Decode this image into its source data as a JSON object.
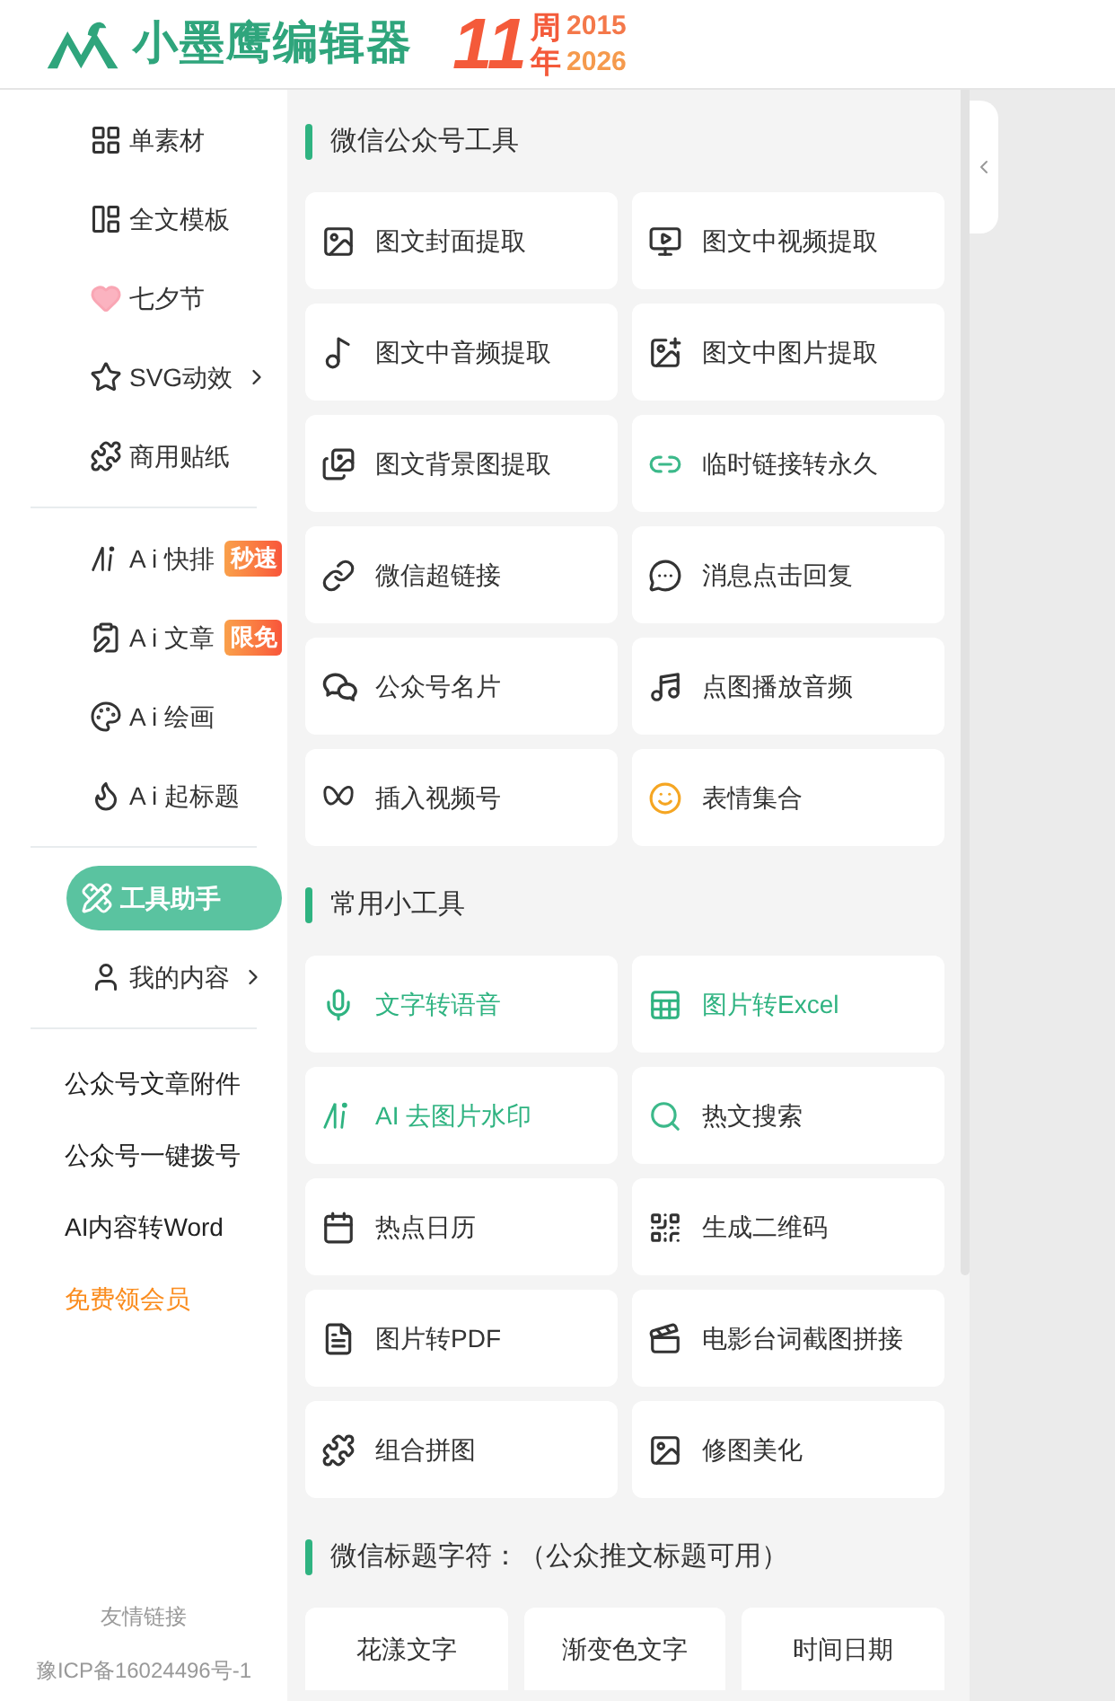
{
  "header": {
    "logo_text": "小墨鹰编辑器",
    "anniversary": {
      "number": "11",
      "label_top": "周",
      "label_bottom": "年",
      "year_start": "2015",
      "year_end": "2026"
    }
  },
  "sidebar": {
    "groups": [
      [
        {
          "label": "单素材",
          "selected": false,
          "has_submenu": false
        },
        {
          "label": "全文模板",
          "selected": false,
          "has_submenu": false
        },
        {
          "label": "七夕节",
          "selected": false,
          "has_submenu": false
        },
        {
          "label": "SVG动效",
          "selected": false,
          "has_submenu": true
        },
        {
          "label": "商用贴纸",
          "selected": false,
          "has_submenu": false
        }
      ],
      [
        {
          "label": "A i 快排",
          "selected": false,
          "has_submenu": false,
          "badge": "秒速"
        },
        {
          "label": "A i 文章",
          "selected": false,
          "has_submenu": false,
          "badge": "限免"
        },
        {
          "label": "A i 绘画",
          "selected": false,
          "has_submenu": false
        },
        {
          "label": "A i 起标题",
          "selected": false,
          "has_submenu": false
        }
      ],
      [
        {
          "label": "工具助手",
          "selected": true,
          "has_submenu": false
        },
        {
          "label": "我的内容",
          "selected": false,
          "has_submenu": true
        }
      ]
    ],
    "links": [
      {
        "label": "公众号文章附件",
        "kind": "plain"
      },
      {
        "label": "公众号一键拨号",
        "kind": "plain"
      },
      {
        "label": "AI内容转Word",
        "kind": "plain"
      },
      {
        "label": "免费领会员",
        "kind": "promo"
      }
    ],
    "footer": {
      "friend_links": "友情链接",
      "icp": "豫ICP备16024496号-1"
    }
  },
  "sections": [
    {
      "title": "微信公众号工具",
      "kind": "cards",
      "tools": [
        {
          "label": "图文封面提取",
          "highlighted": false
        },
        {
          "label": "图文中视频提取",
          "highlighted": false
        },
        {
          "label": "图文中音频提取",
          "highlighted": false
        },
        {
          "label": "图文中图片提取",
          "highlighted": false
        },
        {
          "label": "图文背景图提取",
          "highlighted": false
        },
        {
          "label": "临时链接转永久",
          "highlighted": false
        },
        {
          "label": "微信超链接",
          "highlighted": false
        },
        {
          "label": "消息点击回复",
          "highlighted": false
        },
        {
          "label": "公众号名片",
          "highlighted": false
        },
        {
          "label": "点图播放音频",
          "highlighted": false
        },
        {
          "label": "插入视频号",
          "highlighted": false
        },
        {
          "label": "表情集合",
          "highlighted": false
        }
      ]
    },
    {
      "title": "常用小工具",
      "kind": "cards",
      "tools": [
        {
          "label": "文字转语音",
          "highlighted": true
        },
        {
          "label": "图片转Excel",
          "highlighted": true
        },
        {
          "label": "AI 去图片水印",
          "highlighted": true
        },
        {
          "label": "热文搜索",
          "highlighted": false
        },
        {
          "label": "热点日历",
          "highlighted": false
        },
        {
          "label": "生成二维码",
          "highlighted": false
        },
        {
          "label": "图片转PDF",
          "highlighted": false
        },
        {
          "label": "电影台词截图拼接",
          "highlighted": false
        },
        {
          "label": "组合拼图",
          "highlighted": false
        },
        {
          "label": "修图美化",
          "highlighted": false
        }
      ]
    },
    {
      "title": "微信标题字符：（公众推文标题可用）",
      "kind": "chips",
      "tools": [
        {
          "label": "花漾文字",
          "highlighted": false
        },
        {
          "label": "渐变色文字",
          "highlighted": false
        },
        {
          "label": "时间日期",
          "highlighted": false
        }
      ]
    }
  ]
}
